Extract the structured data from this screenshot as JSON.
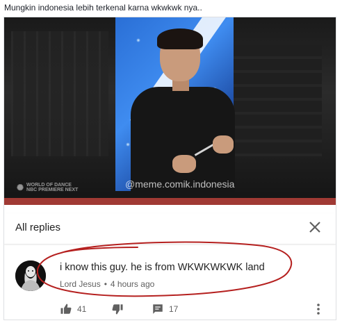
{
  "post": {
    "caption": "Mungkin indonesia lebih terkenal karna wkwkwk nya.."
  },
  "video": {
    "watermark": "@meme.comik.indonesia",
    "network_logo": "NBC",
    "network_tag_line1": "WORLD OF DANCE",
    "network_tag_line2": "PREMIERE NEXT"
  },
  "replies": {
    "title": "All replies",
    "close_icon": "close-icon"
  },
  "comment": {
    "text": "i know this guy. he is from WKWKWKWK land",
    "author": "Lord Jesus",
    "separator": "•",
    "time": "4 hours ago",
    "likes": "41",
    "replies_count": "17"
  },
  "colors": {
    "annotation_red": "#b5201f",
    "meta_gray": "#606060",
    "text_dark": "#212121"
  }
}
